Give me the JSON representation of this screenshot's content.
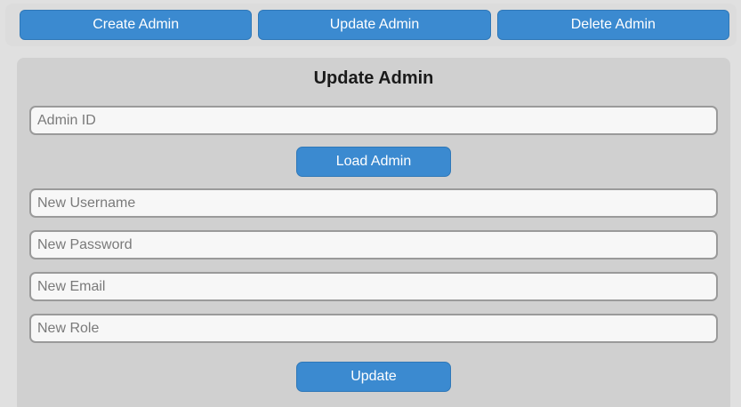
{
  "tabs": [
    {
      "label": "Create Admin"
    },
    {
      "label": "Update Admin"
    },
    {
      "label": "Delete Admin"
    }
  ],
  "form": {
    "title": "Update Admin",
    "admin_id": {
      "placeholder": "Admin ID",
      "value": ""
    },
    "load_button": "Load Admin",
    "username": {
      "placeholder": "New Username",
      "value": ""
    },
    "password": {
      "placeholder": "New Password",
      "value": ""
    },
    "email": {
      "placeholder": "New Email",
      "value": ""
    },
    "role": {
      "placeholder": "New Role",
      "value": ""
    },
    "update_button": "Update"
  },
  "colors": {
    "accent": "#3b8ad0",
    "panel_bg": "#d0d0d0",
    "page_bg": "#e0e0e0"
  }
}
